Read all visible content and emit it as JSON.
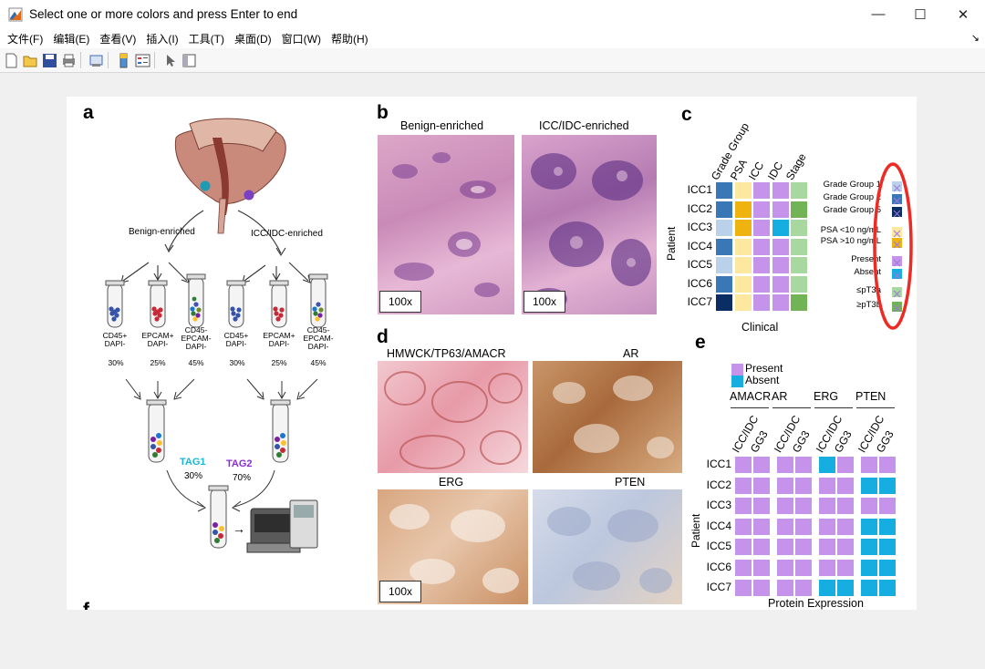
{
  "window": {
    "title": "Select one or more colors and press Enter to end"
  },
  "menu": [
    {
      "label": "文件(F)"
    },
    {
      "label": "编辑(E)"
    },
    {
      "label": "查看(V)"
    },
    {
      "label": "插入(I)"
    },
    {
      "label": "工具(T)"
    },
    {
      "label": "桌面(D)"
    },
    {
      "label": "窗口(W)"
    },
    {
      "label": "帮助(H)"
    }
  ],
  "toolbar": [
    "new-icon",
    "open-icon",
    "save-icon",
    "print-icon",
    "print-preview-icon",
    "colorbar-icon",
    "legend-icon",
    "pointer-icon",
    "property-editor-icon"
  ],
  "figure": {
    "panel_a": {
      "label": "a",
      "branch_left": "Benign-enriched",
      "branch_right": "ICC/IDC-enriched",
      "tubes": [
        {
          "label": "CD45+\nDAPI-",
          "pct": "30%"
        },
        {
          "label": "EPCAM+\nDAPI-",
          "pct": "25%"
        },
        {
          "label": "CD45-\nEPCAM-\nDAPI-",
          "pct": "45%"
        },
        {
          "label": "CD45+\nDAPI-",
          "pct": "30%"
        },
        {
          "label": "EPCAM+\nDAPI-",
          "pct": "25%"
        },
        {
          "label": "CD45-\nEPCAM-\nDAPI-",
          "pct": "45%"
        }
      ],
      "tag1": {
        "name": "TAG1",
        "pct": "30%"
      },
      "tag2": {
        "name": "TAG2",
        "pct": "70%"
      },
      "arrow": "→"
    },
    "panel_b": {
      "label": "b",
      "left_title": "Benign-enriched",
      "right_title": "ICC/IDC-enriched",
      "mag": "100x"
    },
    "panel_c": {
      "label": "c",
      "columns": [
        "Grade Group",
        "PSA",
        "ICC",
        "IDC",
        "Stage"
      ],
      "rows": [
        "ICC1",
        "ICC2",
        "ICC3",
        "ICC4",
        "ICC5",
        "ICC6",
        "ICC7"
      ],
      "ylabel": "Patient",
      "xlabel": "Clinical",
      "cells": [
        [
          "#3a77b6",
          "#fde8a0",
          "#c594ea",
          "#c594ea",
          "#a8d8a0"
        ],
        [
          "#3a77b6",
          "#efb30f",
          "#c594ea",
          "#c594ea",
          "#72b356"
        ],
        [
          "#b9d2ea",
          "#efb30f",
          "#c594ea",
          "#16aee0",
          "#a8d8a0"
        ],
        [
          "#3a77b6",
          "#fde8a0",
          "#c594ea",
          "#c594ea",
          "#a8d8a0"
        ],
        [
          "#b9d2ea",
          "#fde8a0",
          "#c594ea",
          "#c594ea",
          "#a8d8a0"
        ],
        [
          "#3a77b6",
          "#fde8a0",
          "#c594ea",
          "#c594ea",
          "#a8d8a0"
        ],
        [
          "#0a2d63",
          "#fde8a0",
          "#c594ea",
          "#c594ea",
          "#72b356"
        ]
      ],
      "legend": [
        {
          "text": "Grade Group 1",
          "color": "#b9d2ea"
        },
        {
          "text": "Grade Group 2",
          "color": "#3a77b6"
        },
        {
          "text": "Grade Group 5",
          "color": "#0a2d63"
        },
        {
          "text": "PSA <10 ng/mL",
          "color": "#fde8a0"
        },
        {
          "text": "PSA >10 ng/mL",
          "color": "#efb30f"
        },
        {
          "text": "Present",
          "color": "#c594ea"
        },
        {
          "text": "Absent",
          "color": "#16aee0"
        },
        {
          "text": "≤pT3a",
          "color": "#a8d8a0"
        },
        {
          "text": "≥pT3b",
          "color": "#72b356"
        }
      ]
    },
    "panel_d": {
      "label": "d",
      "titles": [
        "HMWCK/TP63/AMACR",
        "AR",
        "ERG",
        "PTEN"
      ],
      "mag": "100x"
    },
    "panel_e": {
      "label": "e",
      "legend": [
        {
          "text": "Present",
          "color": "#c594ea"
        },
        {
          "text": "Absent",
          "color": "#16aee0"
        }
      ],
      "groups": [
        "AMACR",
        "AR",
        "ERG",
        "PTEN"
      ],
      "subcols": [
        "ICC/IDC",
        "GG3"
      ],
      "rows": [
        "ICC1",
        "ICC2",
        "ICC3",
        "ICC4",
        "ICC5",
        "ICC6",
        "ICC7"
      ],
      "ylabel": "Patient",
      "xlabel": "Protein Expression",
      "cells": [
        [
          1,
          1,
          1,
          1,
          0,
          1,
          1,
          1
        ],
        [
          1,
          1,
          1,
          1,
          1,
          1,
          0,
          0
        ],
        [
          1,
          1,
          1,
          1,
          1,
          1,
          1,
          1
        ],
        [
          1,
          1,
          1,
          1,
          1,
          1,
          0,
          0
        ],
        [
          1,
          1,
          1,
          1,
          1,
          1,
          0,
          0
        ],
        [
          1,
          1,
          1,
          1,
          1,
          1,
          0,
          0
        ],
        [
          1,
          1,
          1,
          1,
          0,
          0,
          0,
          0
        ]
      ]
    },
    "panel_f": {
      "label": "f"
    },
    "highlight_color": "#ee2a24"
  }
}
